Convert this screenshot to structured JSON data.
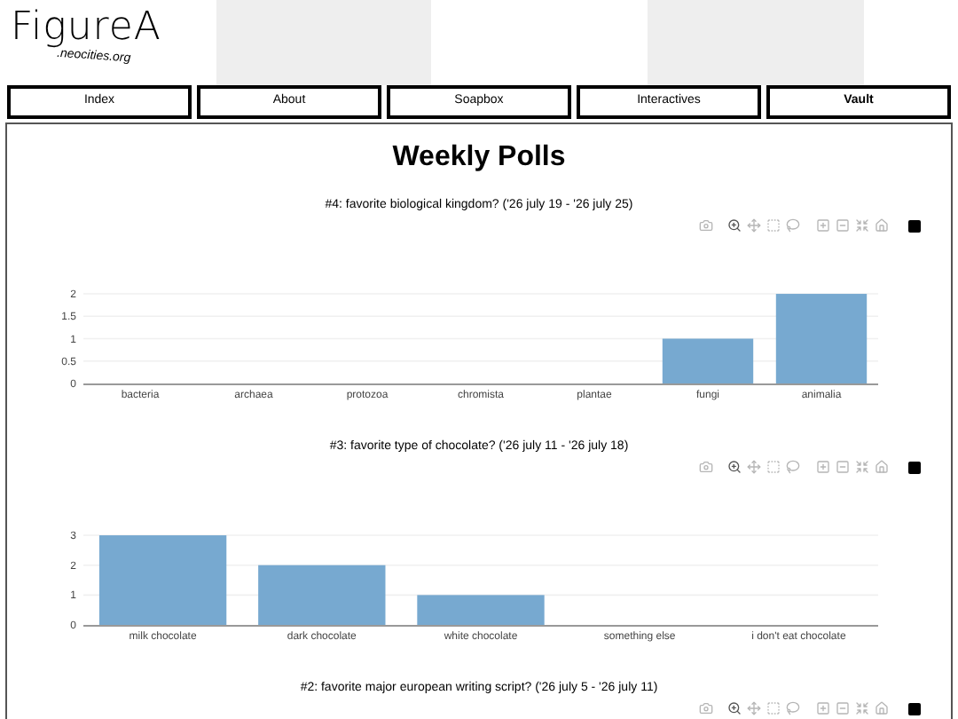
{
  "logo": {
    "title": "FigureA",
    "subtitle": ".neocities.org"
  },
  "nav": [
    {
      "label": "Index",
      "selected": false
    },
    {
      "label": "About",
      "selected": false
    },
    {
      "label": "Soapbox",
      "selected": false
    },
    {
      "label": "Interactives",
      "selected": false
    },
    {
      "label": "Vault",
      "selected": true
    }
  ],
  "heading": "Weekly Polls",
  "polls": [
    {
      "title": "#4: favorite biological kingdom? ('26 july 19 - '26 july 25)",
      "chart_data": {
        "type": "bar",
        "categories": [
          "bacteria",
          "archaea",
          "protozoa",
          "chromista",
          "plantae",
          "fungi",
          "animalia"
        ],
        "series": [
          {
            "color": "#77a9d0",
            "values": [
              0,
              0,
              0,
              0,
              0,
              1,
              2
            ]
          }
        ],
        "grid": true,
        "ylim": [
          0,
          2.1
        ],
        "yticks": [
          0,
          0.5,
          1,
          1.5,
          2
        ]
      }
    },
    {
      "title": "#3: favorite type of chocolate? ('26 july 11 - '26 july 18)",
      "chart_data": {
        "type": "bar",
        "categories": [
          "milk chocolate",
          "dark chocolate",
          "white chocolate",
          "something else",
          "i don't eat chocolate"
        ],
        "series": [
          {
            "color": "#77a9d0",
            "values": [
              3,
              2,
              1,
              0,
              0
            ]
          }
        ],
        "grid": true,
        "ylim": [
          0,
          3.15
        ],
        "yticks": [
          0,
          1,
          2,
          3
        ]
      }
    },
    {
      "title": "#2: favorite major european writing script? ('26 july 5 - '26 july 11)"
    }
  ]
}
